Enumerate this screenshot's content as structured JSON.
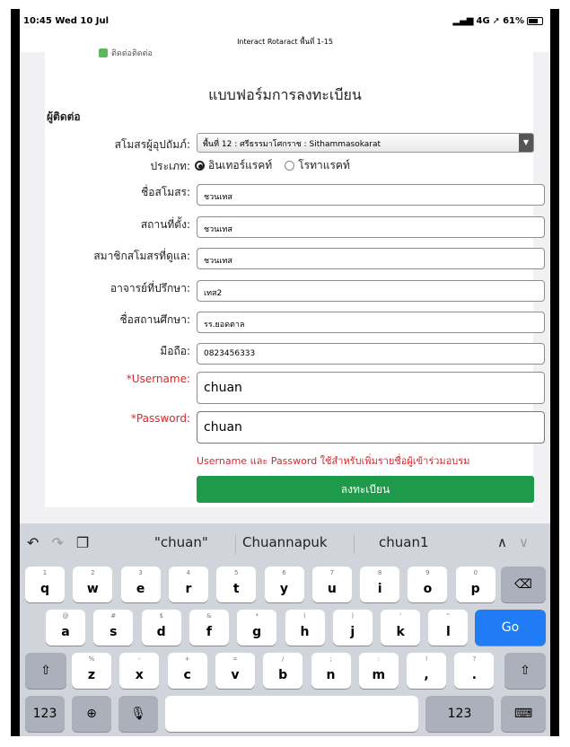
{
  "status_bar": {
    "time": "10:45  Wed 10 Jul",
    "signal": "4G",
    "battery": "61%"
  },
  "page_url": "Interact Rotaract พื้นที่ 1-15",
  "truncated_header": "ติดต่อติดต่อ",
  "form": {
    "title": "แบบฟอร์มการลงทะเบียน",
    "section": "ผู้ติดต่อ",
    "sponsor_label": "สโมสรผู้อุปถัมภ์:",
    "sponsor_value": "พื้นที่ 12 : ศรีธรรมาโศกราช : Sithammasokarat",
    "type_label": "ประเภท:",
    "type_options": [
      "อินเทอร์แรคท์",
      "โรทาแรคท์"
    ],
    "club_name_label": "ชื่อสโมสร:",
    "club_name_value": "ชวนเทส",
    "location_label": "สถานที่ตั้ง:",
    "location_value": "ชวนเทส",
    "supervisor_label": "สมาชิกสโมสรที่ดูแล:",
    "supervisor_value": "ชวนเทส",
    "advisor_label": "อาจารย์ที่ปรึกษา:",
    "advisor_value": "เทส2",
    "school_label": "ชื่อสถานศึกษา:",
    "school_value": "รร.ยอดตาล",
    "mobile_label": "มือถือ:",
    "mobile_value": "0823456333",
    "username_label": "*Username:",
    "username_value": "chuan",
    "password_label": "*Password:",
    "password_value": "chuan",
    "note": "Username และ Password ใช้สำหรับเพิ่มรายชื่อผู้เข้าร่วมอบรม",
    "submit_label": "ลงทะเบียน"
  },
  "keyboard": {
    "suggestions": [
      "\"chuan\"",
      "Chuannapuk",
      "chuan1"
    ],
    "row1": [
      [
        "1",
        "q"
      ],
      [
        "2",
        "w"
      ],
      [
        "3",
        "e"
      ],
      [
        "4",
        "r"
      ],
      [
        "5",
        "t"
      ],
      [
        "6",
        "y"
      ],
      [
        "7",
        "u"
      ],
      [
        "8",
        "i"
      ],
      [
        "9",
        "o"
      ],
      [
        "0",
        "p"
      ]
    ],
    "row2": [
      [
        "@",
        "a"
      ],
      [
        "#",
        "s"
      ],
      [
        "$",
        "d"
      ],
      [
        "&",
        "f"
      ],
      [
        "*",
        "g"
      ],
      [
        "(",
        "h"
      ],
      [
        ")",
        "j"
      ],
      [
        "'",
        "k"
      ],
      [
        "\"",
        "l"
      ]
    ],
    "row3": [
      [
        "%",
        "z"
      ],
      [
        "-",
        "x"
      ],
      [
        "+",
        "c"
      ],
      [
        "=",
        "v"
      ],
      [
        "/",
        "b"
      ],
      [
        ";",
        "n"
      ],
      [
        ":",
        "m"
      ],
      [
        "!",
        ","
      ],
      [
        "?",
        "."
      ]
    ],
    "go_label": "Go",
    "num_label": "123"
  }
}
